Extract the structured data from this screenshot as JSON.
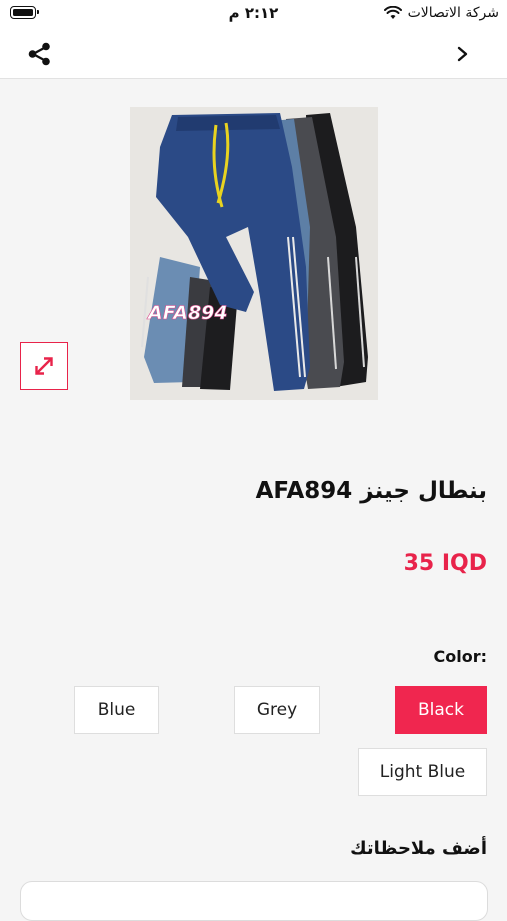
{
  "status_bar": {
    "carrier": "شركة الاتصالات",
    "time": "٢:١٢ م"
  },
  "icons": {
    "share": "share-icon",
    "back": "chevron-right-icon",
    "expand": "expand-arrows-icon"
  },
  "product": {
    "image_caption": "AFA894",
    "title": "بنطال جينز AFA894",
    "price": "35 IQD"
  },
  "color": {
    "label": "Color:",
    "options": [
      "Black",
      "Grey",
      "Blue",
      "Light Blue"
    ],
    "selected": "Black"
  },
  "notes": {
    "label": "أضف ملاحظاتك",
    "placeholder": ""
  },
  "colors": {
    "accent": "#f0264f",
    "background": "#f5f5f5"
  }
}
